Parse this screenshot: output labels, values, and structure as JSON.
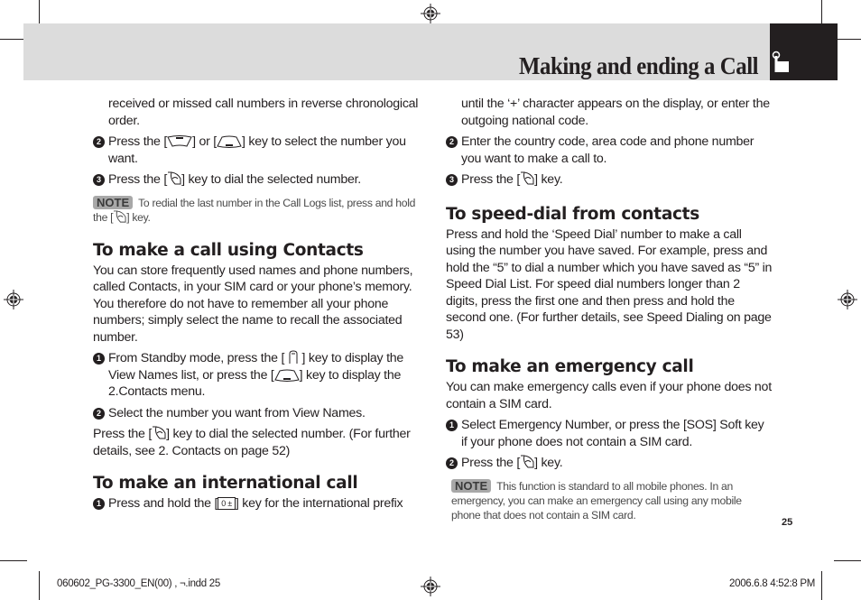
{
  "header": {
    "title": "Making and ending a Call",
    "tab_icon": "hand-pointer-icon"
  },
  "left_column": {
    "intro_continuation": "received or missed call numbers in reverse chronological order.",
    "steps": [
      {
        "number": "2",
        "before": "Press the [",
        "key1": "up-nav-key",
        "middle": "] or [",
        "key2": "down-nav-key",
        "after": "] key to select the number you want."
      },
      {
        "number": "3",
        "before": "Press the [",
        "key": "send-key",
        "after": "] key to dial the selected number."
      }
    ],
    "note": {
      "badge": "NOTE",
      "before": "To redial the last number in the Call Logs list, press and hold the [",
      "key": "send-key",
      "after": "] key."
    },
    "contacts_section": {
      "heading": "To make a call using Contacts",
      "body": "You can store frequently used names and phone numbers, called Contacts, in your SIM card or your phone’s memory. You therefore do not have to remember all your phone numbers; simply select the name to recall the associated number.",
      "steps": [
        {
          "number": "1",
          "before": "From Standby mode, press the [ ",
          "key1": "soft-key",
          "middle": " ] key to display the View Names list, or press the [",
          "key2": "down-nav-key",
          "after": "] key to display the 2.Contacts menu."
        },
        {
          "number": "2",
          "text": "Select the number you want from View Names."
        }
      ],
      "closing_before": "Press the [",
      "closing_key": "send-key",
      "closing_after": "] key to dial the selected number. (For further details, see 2. Contacts on page 52)"
    },
    "international_section": {
      "heading": "To make an international call",
      "step1_number": "1",
      "step1_before": "Press and hold the [",
      "step1_key_label": "0 ±",
      "step1_after": "] key for the international prefix"
    }
  },
  "right_column": {
    "intl_continuation": "until the ‘+’ character appears on the display, or enter the outgoing national code.",
    "intl_steps": [
      {
        "number": "2",
        "text": "Enter the country code, area code and phone number you want to make a call to."
      },
      {
        "number": "3",
        "before": "Press the [",
        "key": "send-key",
        "after": "] key."
      }
    ],
    "speed_dial_section": {
      "heading": "To speed-dial from contacts",
      "body": "Press and hold the ‘Speed Dial’ number to make a call using the number you have saved. For example, press and hold the “5” to dial a number which you have saved as “5” in Speed Dial List.  For speed dial numbers longer than 2 digits, press the first one and then press and hold the second one.  (For further details, see Speed Dialing on page 53)"
    },
    "emergency_section": {
      "heading": "To make an emergency call",
      "body": "You can make emergency calls even if your phone does not contain a SIM card.",
      "steps": [
        {
          "number": "1",
          "text": "Select Emergency Number, or press the [SOS] Soft key if your phone does not contain a SIM card."
        },
        {
          "number": "2",
          "before": "Press the [",
          "key": "send-key",
          "after": "] key."
        }
      ],
      "note": {
        "badge": "NOTE",
        "text": "This function is standard to all mobile phones. In an emergency, you can make an emergency call using any mobile phone that does not contain a SIM card."
      }
    }
  },
  "page_number": "25",
  "footer": {
    "file_name": "060602_PG-3300_EN(00) , ¬.indd   25",
    "timestamp": "2006.6.8   4:52:8 PM"
  }
}
